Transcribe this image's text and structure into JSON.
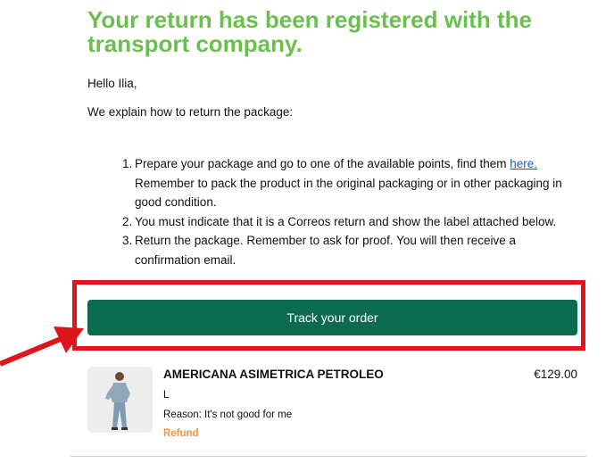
{
  "email": {
    "title": "Your return has been registered with the transport company.",
    "greeting": "Hello Ilia,",
    "intro": "We explain how to return the package:",
    "steps": [
      {
        "number": "1.",
        "text_before_link": "Prepare your package and go to one of the available points, find them ",
        "link_text": "here.",
        "text_after_link": " Remember to pack the product in the original packaging or in other packaging in good condition."
      },
      {
        "number": "2.",
        "text": "You must indicate that it is a Correos return and show the label attached below."
      },
      {
        "number": "3.",
        "text": "Return the package. Remember to ask for proof. You will then receive a confirmation email."
      }
    ],
    "track_button_label": "Track your order"
  },
  "product": {
    "name": "AMERICANA ASIMETRICA PETROLEO",
    "price": "€129.00",
    "size": "L",
    "reason": "Reason: It's not good for me",
    "status": "Refund"
  },
  "colors": {
    "title": "#6bbf4e",
    "button": "#0c6b4f",
    "annotation": "#e0141b",
    "link": "#1a5fb4",
    "status": "#f0924a"
  }
}
